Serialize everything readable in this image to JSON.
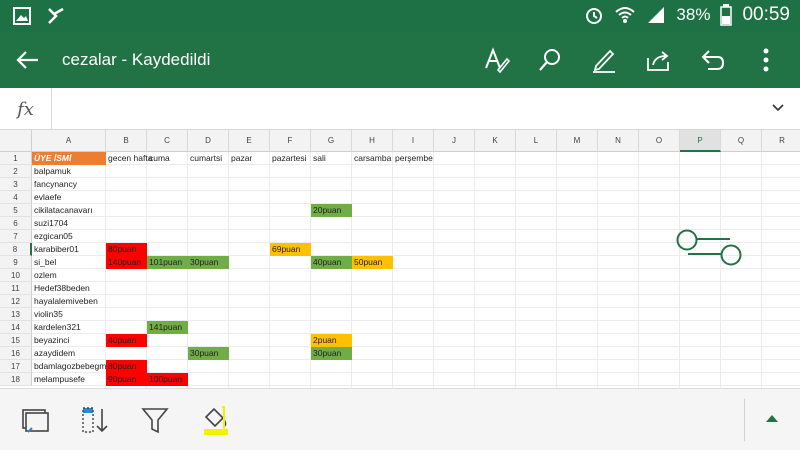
{
  "status_bar": {
    "battery": "38%",
    "time": "00:59"
  },
  "app_bar": {
    "title": "cezalar - Kaydedildi",
    "icons": [
      "back-arrow-icon",
      "text-format-icon",
      "search-icon",
      "pen-draw-icon",
      "share-icon",
      "undo-icon",
      "more-icon"
    ]
  },
  "formula_bar": {
    "fx_label": "fx",
    "value": ""
  },
  "sheet": {
    "columns": [
      "A",
      "B",
      "C",
      "D",
      "E",
      "F",
      "G",
      "H",
      "I",
      "J",
      "K",
      "L",
      "M",
      "N",
      "O",
      "P",
      "Q",
      "R"
    ],
    "selected_column": "P",
    "selected_row": 8,
    "rows": [
      1,
      2,
      3,
      4,
      5,
      6,
      7,
      8,
      9,
      10,
      11,
      12,
      13,
      14,
      15,
      16,
      17,
      18
    ],
    "header_row": [
      "ÜYE İSMİ",
      "gecen hafta",
      "cuma",
      "cumartsi",
      "pazar",
      "pazartesi",
      "sali",
      "carsamba",
      "perşembe"
    ],
    "names": [
      "balpamuk",
      "fancynancy",
      "evlaefe",
      "cikilatacanavarı",
      "suzi1704",
      "ezgican05",
      "karabiber01",
      "si_bel",
      "ozlem",
      "Hedef38beden",
      "hayalalemiveben",
      "violin35",
      "kardelen321",
      "beyazinci",
      "azaydidem",
      "bdamlagozbebegm",
      "melampusefe"
    ],
    "cells": [
      {
        "row": 5,
        "col": "G",
        "text": "20puan",
        "color": "green"
      },
      {
        "row": 8,
        "col": "B",
        "text": "80puan",
        "color": "red"
      },
      {
        "row": 8,
        "col": "F",
        "text": "69puan",
        "color": "orange"
      },
      {
        "row": 9,
        "col": "B",
        "text": "140puan",
        "color": "red"
      },
      {
        "row": 9,
        "col": "C",
        "text": "101puan",
        "color": "green"
      },
      {
        "row": 9,
        "col": "D",
        "text": "30puan",
        "color": "green"
      },
      {
        "row": 9,
        "col": "G",
        "text": "40puan",
        "color": "green"
      },
      {
        "row": 9,
        "col": "H",
        "text": "50puan",
        "color": "orange"
      },
      {
        "row": 14,
        "col": "C",
        "text": "141puan",
        "color": "green"
      },
      {
        "row": 15,
        "col": "B",
        "text": "40puan",
        "color": "red"
      },
      {
        "row": 15,
        "col": "G",
        "text": "2puan",
        "color": "orange"
      },
      {
        "row": 16,
        "col": "D",
        "text": "30puan",
        "color": "green"
      },
      {
        "row": 16,
        "col": "G",
        "text": "30puan",
        "color": "green"
      },
      {
        "row": 17,
        "col": "B",
        "text": "80puan",
        "color": "red"
      },
      {
        "row": 18,
        "col": "B",
        "text": "90puan",
        "color": "red"
      },
      {
        "row": 18,
        "col": "C",
        "text": "100puan",
        "color": "red"
      }
    ]
  },
  "colors": {
    "app_green": "#217346",
    "status_green": "#1e7145",
    "header_orange": "#ed7d31",
    "red": "#ff0000",
    "green": "#70ad47",
    "orange": "#ffc000",
    "accent_yellow": "#f2f200"
  },
  "bottom_bar": {
    "icons": [
      "sheet-view-icon",
      "sort-icon",
      "filter-icon",
      "fill-color-icon",
      "expand-up-icon"
    ]
  }
}
